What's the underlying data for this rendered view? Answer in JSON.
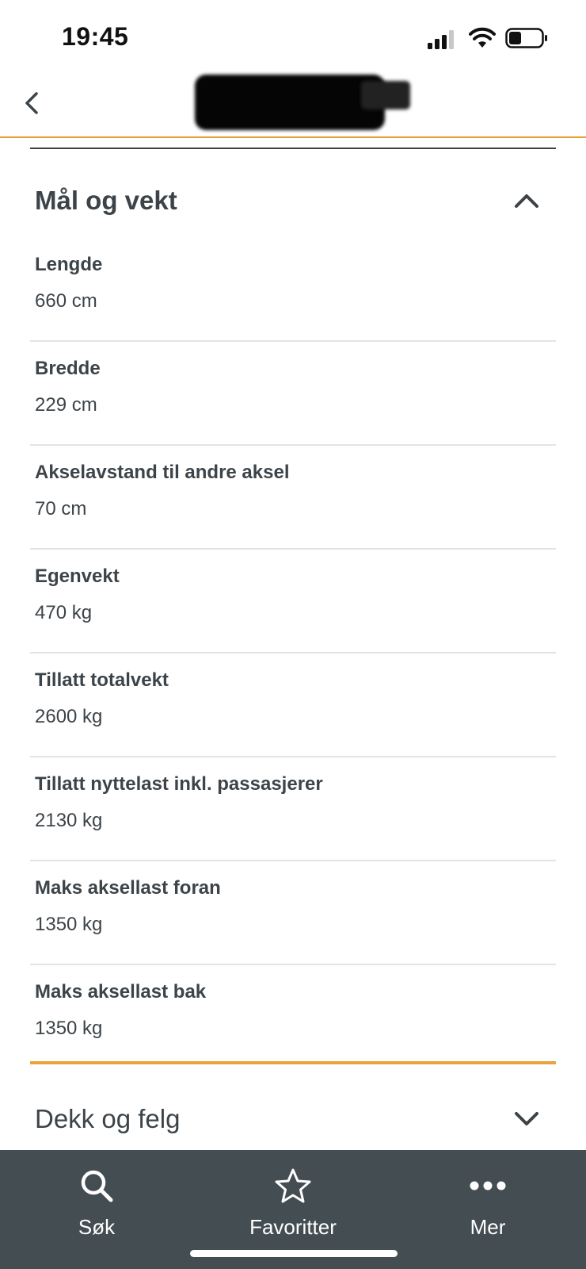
{
  "status": {
    "time": "19:45"
  },
  "section": {
    "title": "Mål og vekt",
    "items": [
      {
        "label": "Lengde",
        "value": "660 cm"
      },
      {
        "label": "Bredde",
        "value": "229 cm"
      },
      {
        "label": "Akselavstand til andre aksel",
        "value": "70 cm"
      },
      {
        "label": "Egenvekt",
        "value": "470 kg"
      },
      {
        "label": "Tillatt totalvekt",
        "value": "2600 kg"
      },
      {
        "label": "Tillatt nyttelast inkl. passasjerer",
        "value": "2130 kg"
      },
      {
        "label": "Maks aksellast foran",
        "value": "1350 kg"
      },
      {
        "label": "Maks aksellast bak",
        "value": "1350 kg"
      }
    ]
  },
  "section2": {
    "title": "Dekk og felg"
  },
  "tabs": [
    {
      "label": "Søk",
      "icon": "search-icon"
    },
    {
      "label": "Favoritter",
      "icon": "star-icon"
    },
    {
      "label": "Mer",
      "icon": "more-icon"
    }
  ],
  "colors": {
    "accent": "#e8a33a",
    "tabbar": "#434d52",
    "text": "#3c4449"
  }
}
